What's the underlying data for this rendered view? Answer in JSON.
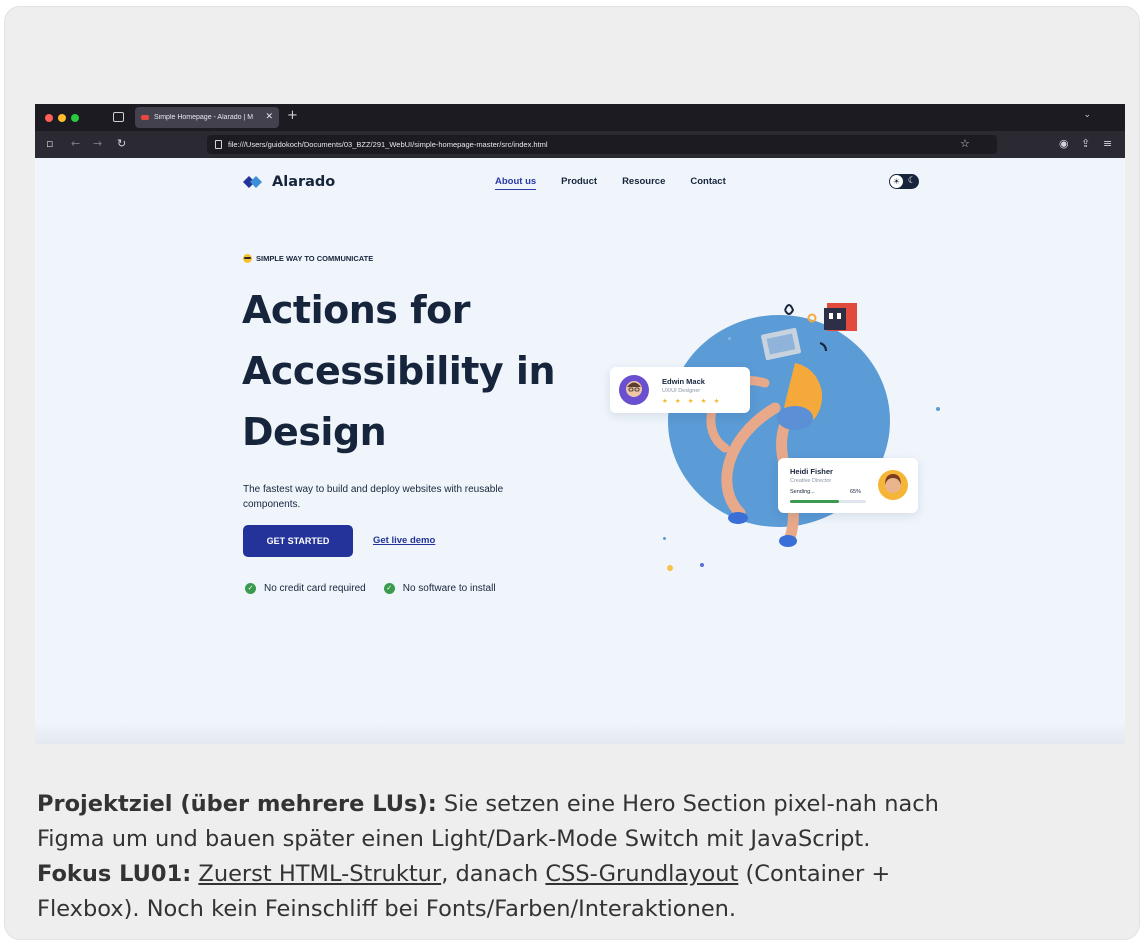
{
  "browser": {
    "tab_title": "Simple Homepage - Alarado | M",
    "tab_close": "✕",
    "new_tab": "+",
    "url": "file:///Users/guidokoch/Documents/03_BZZ/291_WebUI/simple-homepage-master/src/index.html"
  },
  "site": {
    "logo_text": "Alarado",
    "nav": [
      "About us",
      "Product",
      "Resource",
      "Contact"
    ],
    "active_nav_index": 0
  },
  "hero": {
    "eyebrow": "SIMPLE WAY TO COMMUNICATE",
    "title_lines": [
      "Actions for",
      "Accessibility in",
      "Design"
    ],
    "subtitle": "The fastest way to build and deploy websites with reusable components.",
    "cta_label": "GET STARTED",
    "demo_label": "Get live demo",
    "checks": [
      "No credit card required",
      "No software to install"
    ]
  },
  "profile_cards": {
    "edwin": {
      "name": "Edwin Mack",
      "role": "UX/UI Designer",
      "stars": "★ ★ ★ ★ ★"
    },
    "heidi": {
      "name": "Heidi Fisher",
      "role": "Creative Director",
      "progress_label": "Sending...",
      "progress_value": "65%",
      "progress": 0.65
    }
  },
  "caption": {
    "goal_label": "Projektziel (über mehrere LUs):",
    "goal_text": " Sie setzen eine Hero Section pixel-nah nach",
    "goal_text2": "Figma um und bauen später einen Light/Dark-Mode Switch mit JavaScript.",
    "focus_label": "Fokus LU01:",
    "focus_link1": "Zuerst HTML-Struktur",
    "focus_mid": ", danach ",
    "focus_link2": "CSS-Grundlayout",
    "focus_tail": " (Container +",
    "focus_text2": "Flexbox). Noch kein Feinschliff bei Fonts/Farben/Interaktionen."
  },
  "colors": {
    "brand": "#233399",
    "text_dark": "#17253c",
    "page_bg": "#eff5fb",
    "circle": "#5b9bd6",
    "check": "#3a9b4e"
  }
}
